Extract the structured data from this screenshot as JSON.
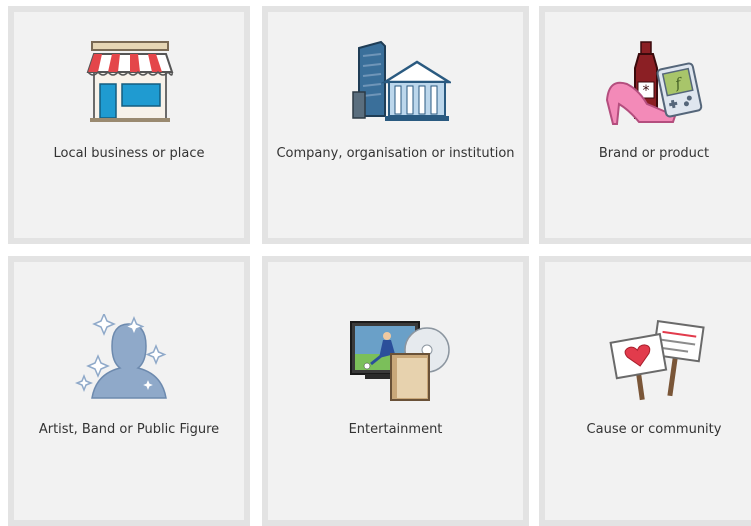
{
  "categories": [
    {
      "label": "Local business or place",
      "icon": "storefront-icon"
    },
    {
      "label": "Company, organisation or institution",
      "icon": "buildings-icon"
    },
    {
      "label": "Brand or product",
      "icon": "products-icon"
    },
    {
      "label": "Artist, Band or Public Figure",
      "icon": "person-silhouette-icon"
    },
    {
      "label": "Entertainment",
      "icon": "media-icon"
    },
    {
      "label": "Cause or community",
      "icon": "protest-signs-icon"
    }
  ],
  "colors": {
    "tile_bg": "#f2f2f2",
    "tile_border": "#e3e3e3",
    "label_text": "#333333",
    "awning_red": "#e4464a",
    "store_blue": "#1f9bd1",
    "building_blue": "#3a6f9a",
    "shoe_pink": "#f38ab8",
    "silhouette_blue": "#8fa9c9",
    "heart_red": "#e23b4c"
  }
}
